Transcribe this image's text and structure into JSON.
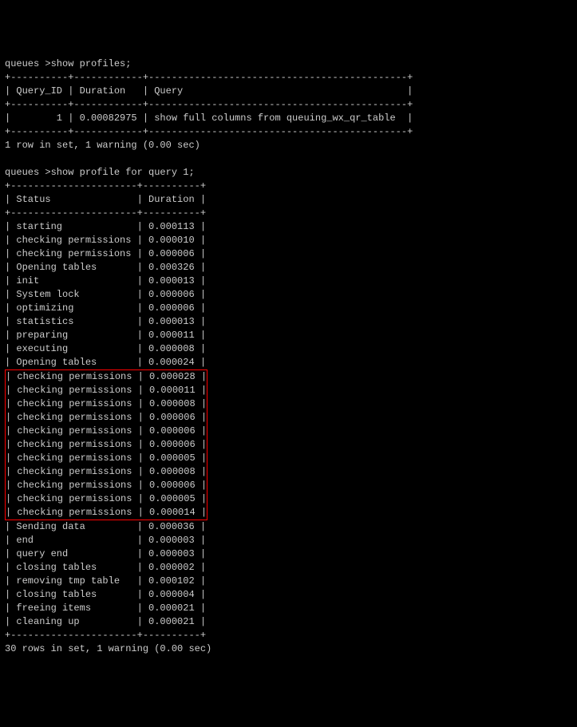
{
  "prompt1_db": "queues >",
  "cmd1": "show profiles;",
  "sep_query_top": "+----------+------------+---------------------------------------------+",
  "hdr_query": "| Query_ID | Duration   | Query                                       |",
  "sep_query_mid": "+----------+------------+---------------------------------------------+",
  "row_query": "|        1 | 0.00082975 | show full columns from queuing_wx_qr_table  |",
  "sep_query_bot": "+----------+------------+---------------------------------------------+",
  "result1": "1 row in set, 1 warning (0.00 sec)",
  "prompt2_db": "queues >",
  "cmd2": "show profile for query 1;",
  "sep_prof_top": "+----------------------+----------+",
  "hdr_prof": "| Status               | Duration |",
  "sep_prof_mid": "+----------------------+----------+",
  "rows_before": [
    "| starting             | 0.000113 |",
    "| checking permissions | 0.000010 |",
    "| checking permissions | 0.000006 |",
    "| Opening tables       | 0.000326 |",
    "| init                 | 0.000013 |",
    "| System lock          | 0.000006 |",
    "| optimizing           | 0.000006 |",
    "| statistics           | 0.000013 |",
    "| preparing            | 0.000011 |",
    "| executing            | 0.000008 |",
    "| Opening tables       | 0.000024 |"
  ],
  "rows_high": [
    "| checking permissions | 0.000028 |",
    "| checking permissions | 0.000011 |",
    "| checking permissions | 0.000008 |",
    "| checking permissions | 0.000006 |",
    "| checking permissions | 0.000006 |",
    "| checking permissions | 0.000006 |",
    "| checking permissions | 0.000005 |",
    "| checking permissions | 0.000008 |",
    "| checking permissions | 0.000006 |",
    "| checking permissions | 0.000005 |",
    "| checking permissions | 0.000014 |"
  ],
  "rows_after": [
    "| Sending data         | 0.000036 |",
    "| end                  | 0.000003 |",
    "| query end            | 0.000003 |",
    "| closing tables       | 0.000002 |",
    "| removing tmp table   | 0.000102 |",
    "| closing tables       | 0.000004 |",
    "| freeing items        | 0.000021 |",
    "| cleaning up          | 0.000021 |"
  ],
  "sep_prof_bot": "+----------------------+----------+",
  "result2": "30 rows in set, 1 warning (0.00 sec)",
  "chart_data": {
    "type": "table",
    "tables": [
      {
        "title": "show profiles",
        "columns": [
          "Query_ID",
          "Duration",
          "Query"
        ],
        "rows": [
          [
            1,
            0.00082975,
            "show full columns from queuing_wx_qr_table"
          ]
        ]
      },
      {
        "title": "show profile for query 1",
        "columns": [
          "Status",
          "Duration"
        ],
        "rows": [
          [
            "starting",
            0.000113
          ],
          [
            "checking permissions",
            1e-05
          ],
          [
            "checking permissions",
            6e-06
          ],
          [
            "Opening tables",
            0.000326
          ],
          [
            "init",
            1.3e-05
          ],
          [
            "System lock",
            6e-06
          ],
          [
            "optimizing",
            6e-06
          ],
          [
            "statistics",
            1.3e-05
          ],
          [
            "preparing",
            1.1e-05
          ],
          [
            "executing",
            8e-06
          ],
          [
            "Opening tables",
            2.4e-05
          ],
          [
            "checking permissions",
            2.8e-05
          ],
          [
            "checking permissions",
            1.1e-05
          ],
          [
            "checking permissions",
            8e-06
          ],
          [
            "checking permissions",
            6e-06
          ],
          [
            "checking permissions",
            6e-06
          ],
          [
            "checking permissions",
            6e-06
          ],
          [
            "checking permissions",
            5e-06
          ],
          [
            "checking permissions",
            8e-06
          ],
          [
            "checking permissions",
            6e-06
          ],
          [
            "checking permissions",
            5e-06
          ],
          [
            "checking permissions",
            1.4e-05
          ],
          [
            "Sending data",
            3.6e-05
          ],
          [
            "end",
            3e-06
          ],
          [
            "query end",
            3e-06
          ],
          [
            "closing tables",
            2e-06
          ],
          [
            "removing tmp table",
            0.000102
          ],
          [
            "closing tables",
            4e-06
          ],
          [
            "freeing items",
            2.1e-05
          ],
          [
            "cleaning up",
            2.1e-05
          ]
        ]
      }
    ]
  }
}
